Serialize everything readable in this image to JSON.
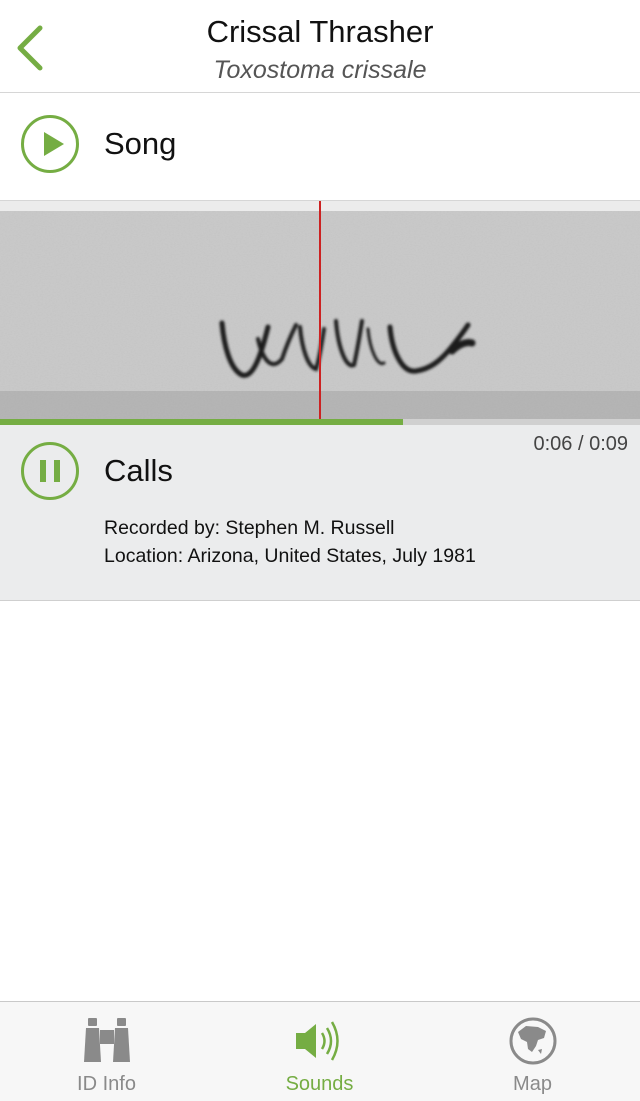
{
  "header": {
    "title": "Crissal Thrasher",
    "subtitle": "Toxostoma crissale"
  },
  "recordings": [
    {
      "label": "Song",
      "state": "stopped"
    },
    {
      "label": "Calls",
      "state": "playing",
      "recorded_by": "Recorded by: Stephen M. Russell",
      "location": "Location: Arizona, United States, July 1981"
    }
  ],
  "player": {
    "time_readout": "0:06 / 0:09",
    "progress_fraction": 0.63,
    "playhead_fraction": 0.5
  },
  "tabs": [
    {
      "label": "ID Info",
      "icon": "binoculars-icon",
      "active": false
    },
    {
      "label": "Sounds",
      "icon": "speaker-icon",
      "active": true
    },
    {
      "label": "Map",
      "icon": "globe-icon",
      "active": false
    }
  ],
  "colors": {
    "accent": "#75ad43",
    "playhead": "#cc2222",
    "panel_background": "#ebeced",
    "tab_inactive": "#8a8a8a"
  }
}
